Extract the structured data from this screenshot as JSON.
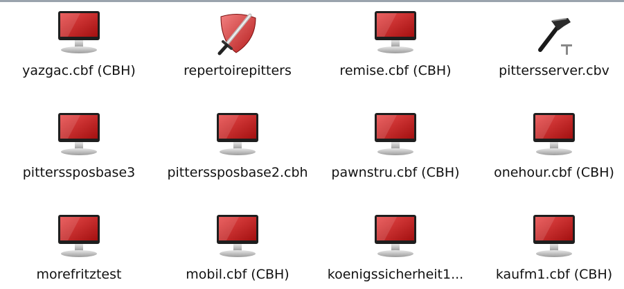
{
  "files": [
    {
      "name": "yazgac.cbf (CBH)",
      "icon": "monitor-icon"
    },
    {
      "name": "repertoirepitters",
      "icon": "shield-sword-icon"
    },
    {
      "name": "remise.cbf (CBH)",
      "icon": "monitor-icon"
    },
    {
      "name": "pittersserver.cbv",
      "icon": "hammer-icon"
    },
    {
      "name": "pitterssposbase3",
      "icon": "monitor-icon"
    },
    {
      "name": "pitterssposbase2.cbh",
      "icon": "monitor-icon"
    },
    {
      "name": "pawnstru.cbf (CBH)",
      "icon": "monitor-icon"
    },
    {
      "name": "onehour.cbf (CBH)",
      "icon": "monitor-icon"
    },
    {
      "name": "morefritztest",
      "icon": "monitor-icon"
    },
    {
      "name": "mobil.cbf (CBH)",
      "icon": "monitor-icon"
    },
    {
      "name": "koenigssicherheit1...",
      "icon": "monitor-icon"
    },
    {
      "name": "kaufm1.cbf (CBH)",
      "icon": "monitor-icon"
    }
  ],
  "colors": {
    "screen_red": "#d42a2a",
    "bezel": "#222222",
    "stand": "#c8c8c8",
    "border_top": "#9aa3ad"
  }
}
